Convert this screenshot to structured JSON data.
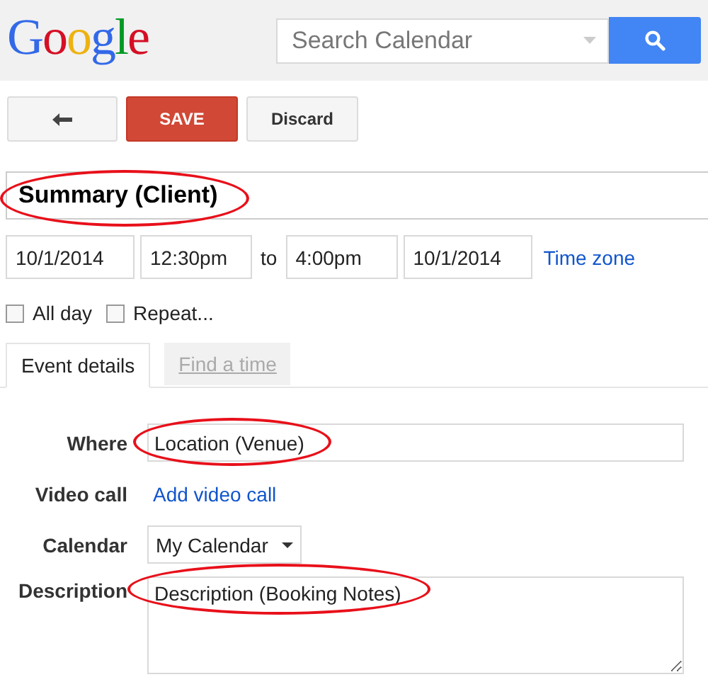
{
  "header": {
    "logo": "Google",
    "search": {
      "placeholder": "Search Calendar"
    }
  },
  "toolbar": {
    "save": "SAVE",
    "discard": "Discard"
  },
  "title": {
    "value": "Summary (Client)",
    "circled": true
  },
  "when": {
    "start_date": "10/1/2014",
    "start_time": "12:30pm",
    "separator": "to",
    "end_time": "4:00pm",
    "end_date": "10/1/2014",
    "time_zone": "Time zone"
  },
  "options": [
    {
      "label": "All day",
      "checked": false
    },
    {
      "label": "Repeat...",
      "checked": false
    }
  ],
  "tabs": [
    {
      "label": "Event details",
      "selected": true
    },
    {
      "label": "Find a time",
      "selected": false
    }
  ],
  "form": [
    {
      "kind": "input",
      "label": "Where",
      "value": "Location (Venue)",
      "circled": true
    },
    {
      "kind": "link",
      "label": "Video call",
      "value": "Add video call"
    },
    {
      "kind": "select",
      "label": "Calendar",
      "value": "My Calendar"
    },
    {
      "kind": "textarea",
      "label": "Description",
      "value": "Description (Booking Notes)",
      "circled": true
    }
  ]
}
